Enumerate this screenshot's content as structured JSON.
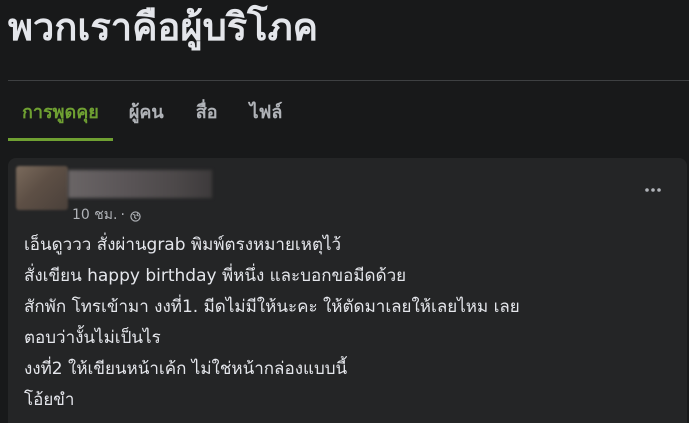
{
  "group": {
    "title": "พวกเราคือผู้บริโภค"
  },
  "tabs": [
    {
      "label": "การพูดคุย",
      "active": true
    },
    {
      "label": "ผู้คน",
      "active": false
    },
    {
      "label": "สื่อ",
      "active": false
    },
    {
      "label": "ไฟล์",
      "active": false
    }
  ],
  "post": {
    "timestamp": "10 ชม.",
    "separator": "·",
    "privacy_icon": "globe-icon",
    "menu_icon": "more-horizontal-icon",
    "lines": [
      "เอ็นดูววว สั่งผ่านgrab พิมพ์ตรงหมายเหตุไว้",
      "สั่งเขียน happy birthday พี่หนึ่ง และบอกขอมีดด้วย",
      "สักพัก โทรเข้ามา  งงที่1. มีดไม่มีให้นะคะ ให้ตัดมาเลยให้เลยไหม เลย",
      "ตอบว่างั้นไม่เป็นไร",
      "งงที่2 ให้เขียนหน้าเค้ก ไม่ใช่หน้ากล่องแบบนี้",
      "โอ้ยขำ"
    ]
  },
  "colors": {
    "background": "#18191a",
    "card": "#242526",
    "accent": "#6fa032",
    "text_primary": "#e4e6eb",
    "text_secondary": "#b0b3b8",
    "divider": "#3e4042"
  }
}
